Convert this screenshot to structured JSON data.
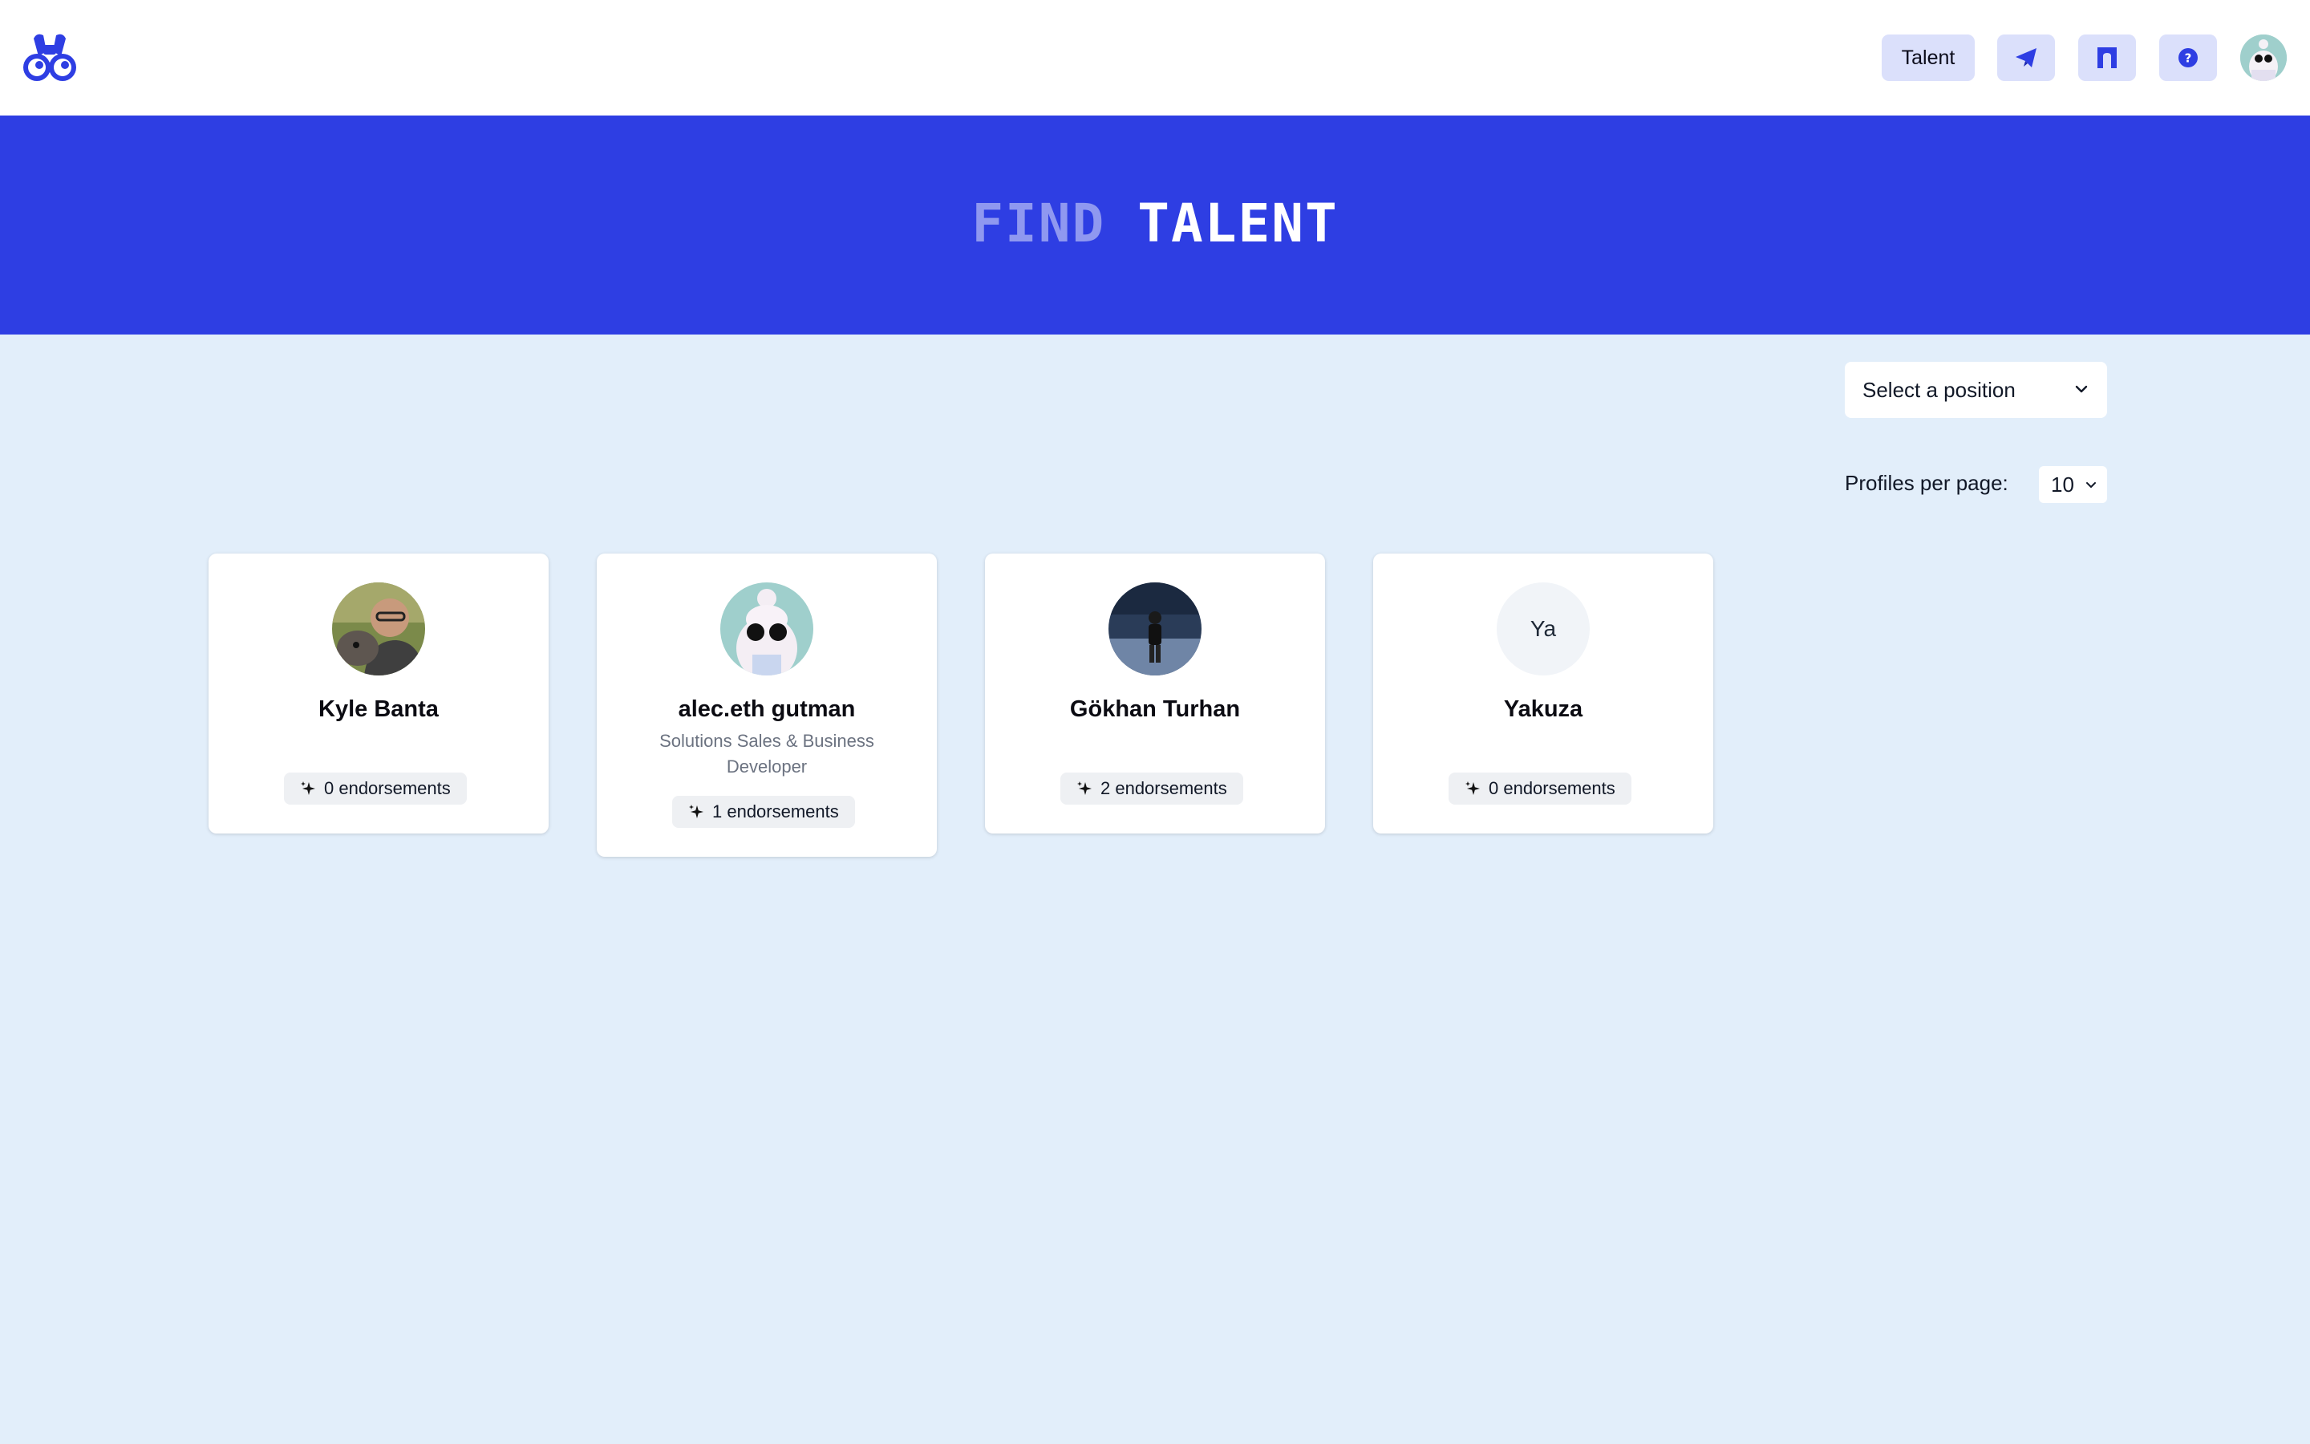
{
  "header": {
    "nav_talent_label": "Talent",
    "icons": [
      "binoculars-logo",
      "send-icon",
      "gate-icon",
      "help-icon",
      "user-avatar"
    ],
    "accent": "#2e3ee3"
  },
  "hero": {
    "title_word1": "FIND",
    "title_word2": "TALENT"
  },
  "filters": {
    "position_select": "Select a position",
    "profiles_per_page_label": "Profiles per page:",
    "profiles_per_page_value": "10"
  },
  "profiles": [
    {
      "name": "Kyle Banta",
      "subtitle": "",
      "endorsements": "0 endorsements"
    },
    {
      "name": "alec.eth gutman",
      "subtitle": "Solutions Sales & Business Developer",
      "endorsements": "1 endorsements"
    },
    {
      "name": "Gökhan Turhan",
      "subtitle": "",
      "endorsements": "2 endorsements"
    },
    {
      "name": "Yakuza",
      "subtitle": "",
      "initials": "Ya",
      "endorsements": "0 endorsements"
    }
  ]
}
